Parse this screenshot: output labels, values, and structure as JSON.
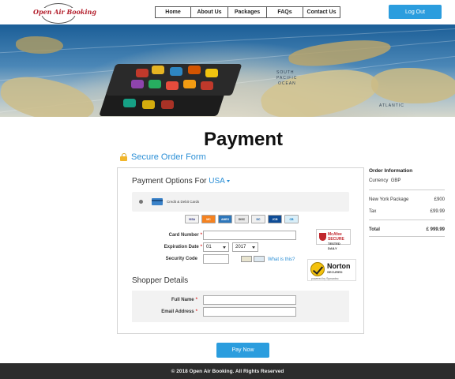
{
  "header": {
    "logo_text": "Open Air Booking",
    "nav": [
      "Home",
      "About Us",
      "Packages",
      "FAQs",
      "Contact Us"
    ],
    "logout_label": "Log Out"
  },
  "hero": {
    "map_labels": [
      "SOUTH",
      "PACIFIC",
      "OCEAN",
      "ATLANTIC"
    ]
  },
  "page_title": "Payment",
  "secure_title": "Secure Order Form",
  "payment": {
    "options_label": "Payment Options For",
    "country": "USA",
    "method_label": "Credit & Debit Cards",
    "card_logos": [
      {
        "name": "VISA",
        "color": "#f3f3f3",
        "text_color": "#1a1f71"
      },
      {
        "name": "MC",
        "color": "#f58220",
        "text_color": "#ffffff"
      },
      {
        "name": "AMEX",
        "color": "#2e77bb",
        "text_color": "#ffffff"
      },
      {
        "name": "DISC",
        "color": "#e9e9e9",
        "text_color": "#333333"
      },
      {
        "name": "DC",
        "color": "#f0f0f0",
        "text_color": "#004a97"
      },
      {
        "name": "JCB",
        "color": "#0e4c96",
        "text_color": "#ffffff"
      },
      {
        "name": "CB",
        "color": "#d9eef8",
        "text_color": "#0070ba"
      }
    ],
    "card_number_label": "Card Number",
    "card_number_value": "",
    "expiration_label": "Expiration Date",
    "exp_month": "01",
    "exp_year": "2017",
    "security_code_label": "Security Code",
    "security_code_value": "",
    "whats_this": "What is this?",
    "required_mark": "*"
  },
  "badges": {
    "mcafee_name": "McAfee",
    "mcafee_sub": "SECURE",
    "mcafee_by": "TESTED DAILY",
    "norton_name": "Norton",
    "norton_sub": "SECURED",
    "norton_by": "powered by Symantec"
  },
  "shopper": {
    "heading": "Shopper Details",
    "full_name_label": "Full Name",
    "full_name_value": "",
    "email_label": "Email Address",
    "email_value": ""
  },
  "order": {
    "title": "Order Information",
    "currency_label": "Currency",
    "currency": "GBP",
    "items": [
      {
        "label": "New York Package",
        "value": "£900"
      },
      {
        "label": "Tax",
        "value": "£99.99"
      }
    ],
    "total_label": "Total",
    "total_value": "£ 999.99"
  },
  "pay_button": "Pay Now",
  "footer": "© 2018 Open Air Booking. All Rights Reserved",
  "colors": {
    "accent": "#2b9dde",
    "link": "#2b8fd6",
    "logo_red": "#b3202d",
    "footer_bg": "#2c2c2c"
  }
}
